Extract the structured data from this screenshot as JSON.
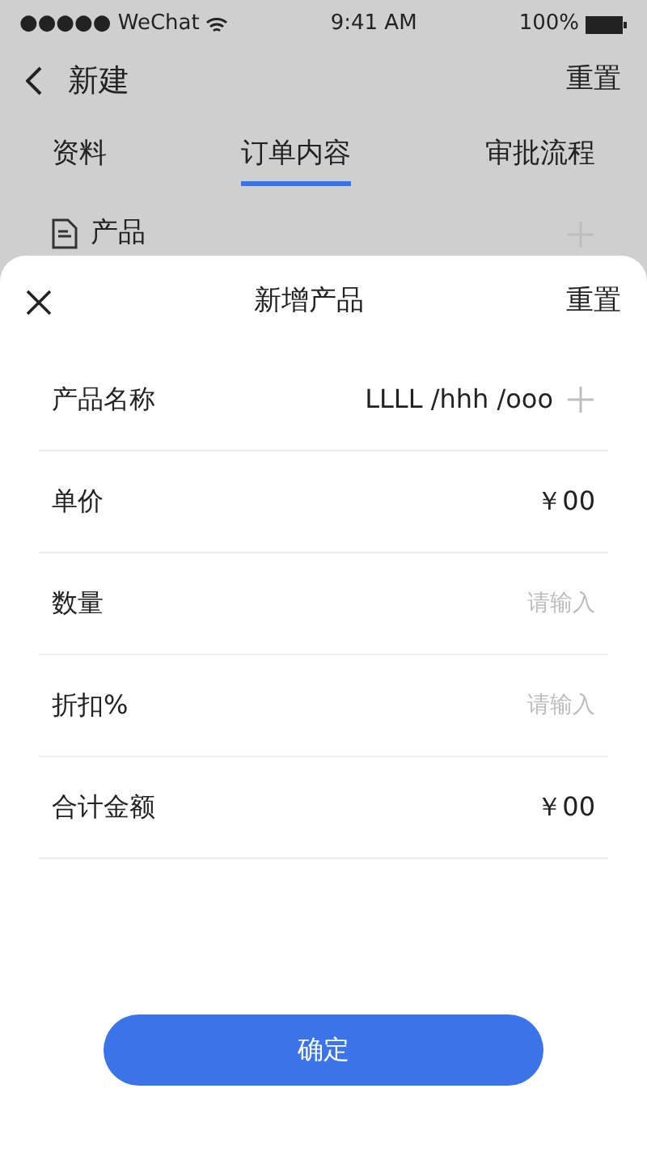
{
  "status_bar": {
    "carrier": "●●●●● WeChat",
    "time": "9:41 AM",
    "battery": "100%"
  },
  "nav": {
    "title": "新建",
    "action": "重置"
  },
  "tabs": [
    {
      "label": "资料",
      "selected": false
    },
    {
      "label": "订单内容",
      "selected": true
    },
    {
      "label": "审批流程",
      "selected": false
    }
  ],
  "section": {
    "title": "产品"
  },
  "sheet": {
    "title": "新增产品",
    "action": "重置",
    "rows": [
      {
        "kind": "picker",
        "label": "产品名称",
        "value": "LLLL /hhh /ooo"
      },
      {
        "kind": "value",
        "label": "单价",
        "value": "￥00"
      },
      {
        "kind": "input",
        "label": "数量",
        "placeholder": "请输入"
      },
      {
        "kind": "input",
        "label": "折扣%",
        "placeholder": "请输入"
      },
      {
        "kind": "value",
        "label": "合计金额",
        "value": "￥00"
      }
    ],
    "confirm": "确定"
  }
}
